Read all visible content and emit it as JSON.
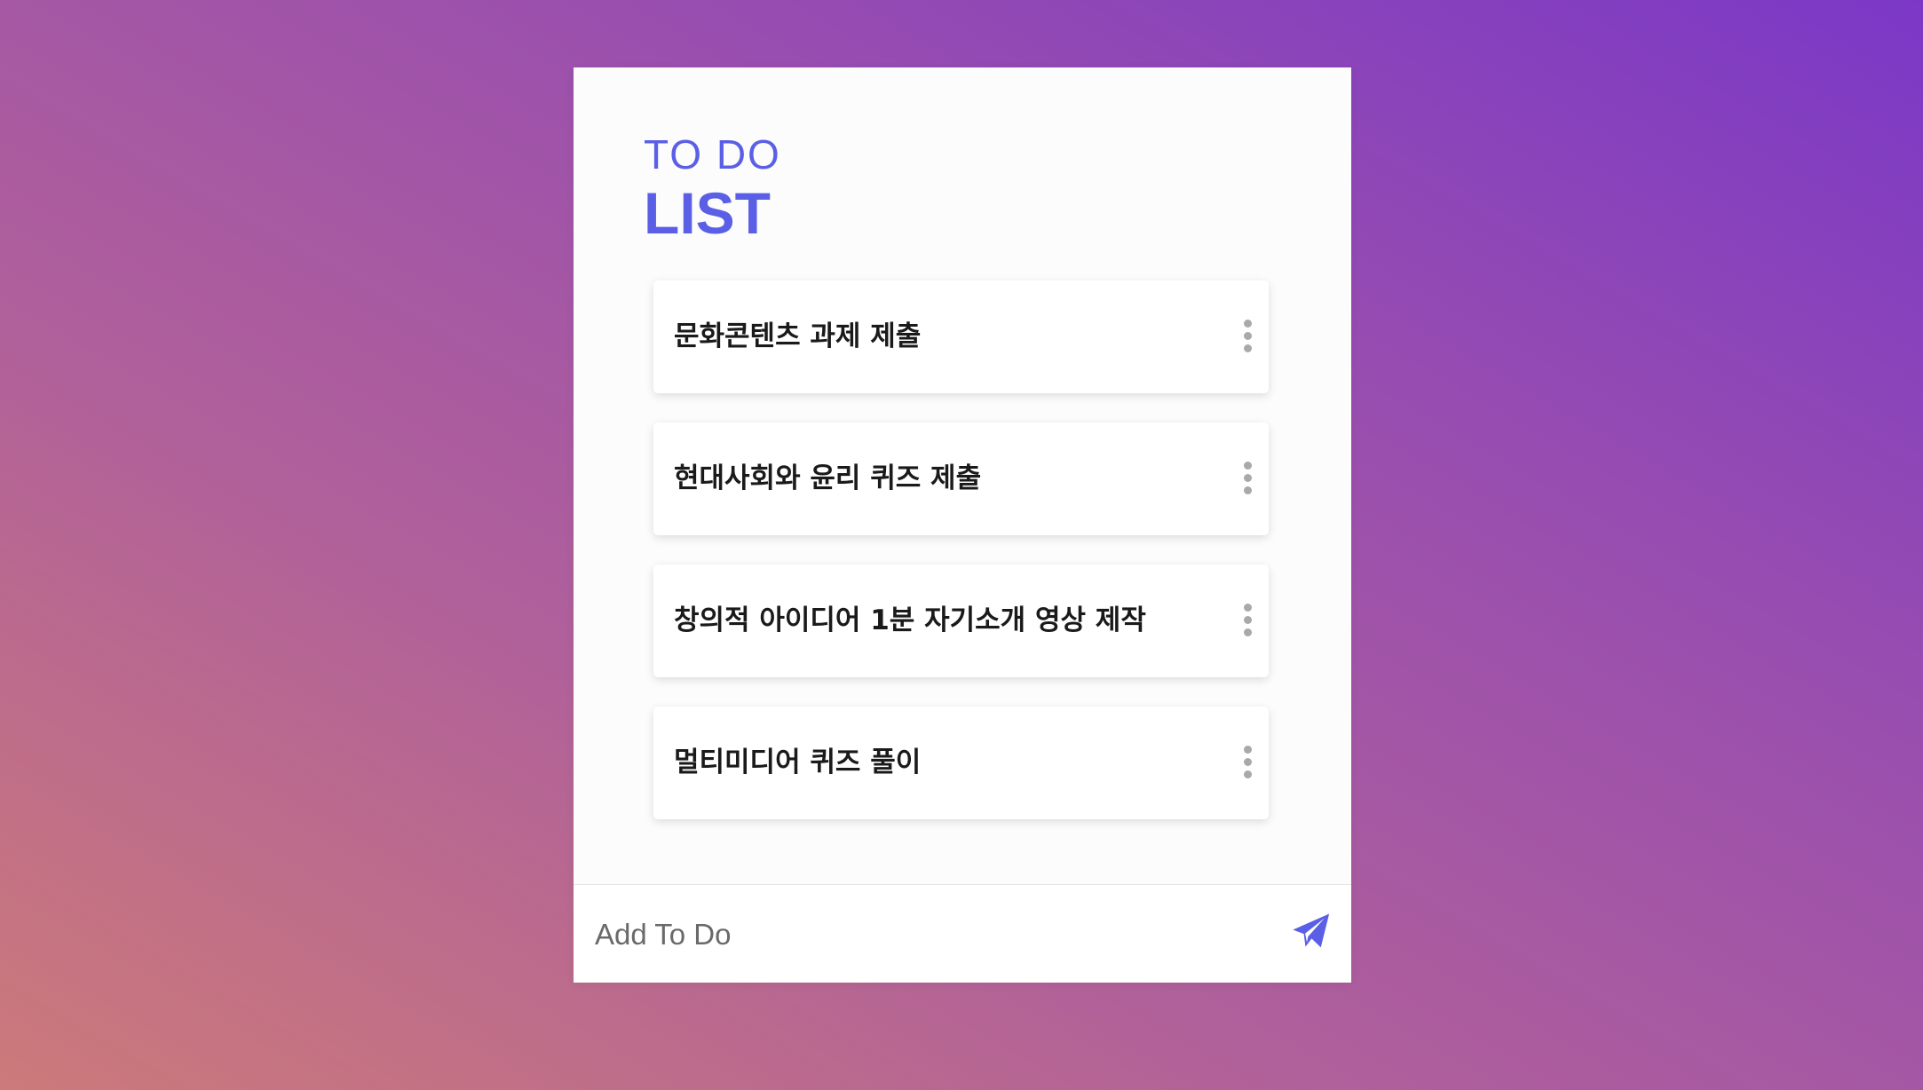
{
  "header": {
    "title_small": "TO DO",
    "title_large": "LIST"
  },
  "todos": [
    {
      "text": "문화콘텐츠 과제 제출",
      "menu_icon": "more-vertical-icon"
    },
    {
      "text": "현대사회와 윤리 퀴즈 제출",
      "menu_icon": "more-vertical-icon"
    },
    {
      "text": "창의적 아이디어 1분 자기소개 영상 제작",
      "menu_icon": "more-vertical-icon"
    },
    {
      "text": "멀티미디어 퀴즈 풀이",
      "menu_icon": "more-vertical-icon"
    }
  ],
  "footer": {
    "input_placeholder": "Add To Do",
    "input_value": "",
    "send_icon": "paper-plane-icon"
  },
  "colors": {
    "accent": "#5b5fe6",
    "card_background": "#fcfcfc",
    "item_background": "#ffffff",
    "kebab_dots": "#a9a9a9"
  }
}
